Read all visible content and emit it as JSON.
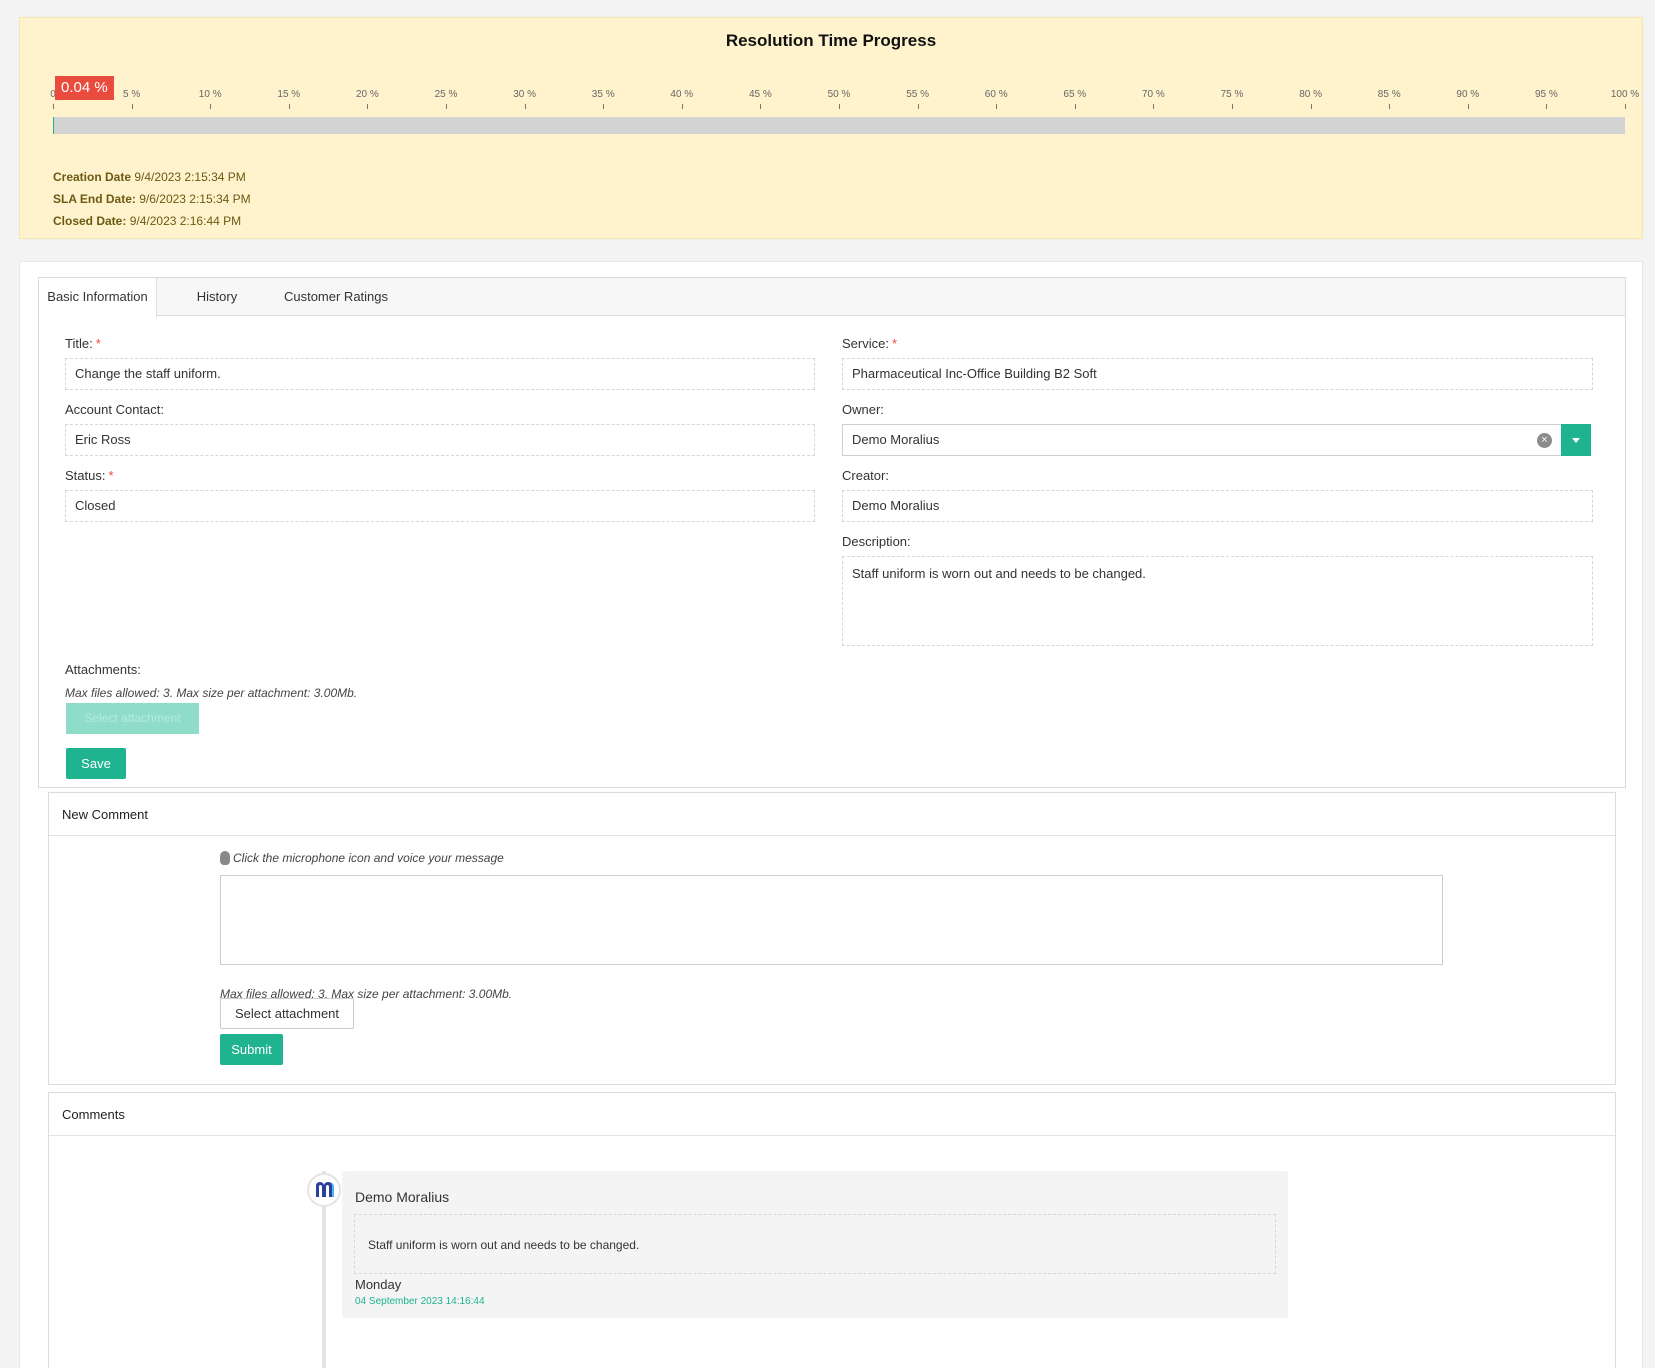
{
  "progress": {
    "title": "Resolution Time Progress",
    "percent_label": "0.04 %",
    "percent_value": 0.04,
    "ticks": [
      "0",
      "5 %",
      "10 %",
      "15 %",
      "20 %",
      "25 %",
      "30 %",
      "35 %",
      "40 %",
      "45 %",
      "50 %",
      "55 %",
      "60 %",
      "65 %",
      "70 %",
      "75 %",
      "80 %",
      "85 %",
      "90 %",
      "95 %",
      "100 %"
    ],
    "creation_label": "Creation Date",
    "creation_value": "9/4/2023 2:15:34 PM",
    "sla_label": "SLA End Date:",
    "sla_value": "9/6/2023 2:15:34 PM",
    "closed_label": "Closed Date:",
    "closed_value": "9/4/2023 2:16:44 PM",
    "colors": {
      "badge": "#e94b3c",
      "fill": "#1fb38f",
      "panel": "#fff3cd"
    }
  },
  "tabs": [
    "Basic Information",
    "History",
    "Customer Ratings"
  ],
  "form": {
    "title_label": "Title:",
    "title_value": "Change the staff uniform.",
    "account_contact_label": "Account Contact:",
    "account_contact_value": "Eric Ross",
    "status_label": "Status:",
    "status_value": "Closed",
    "service_label": "Service:",
    "service_value": "Pharmaceutical Inc-Office Building B2 Soft",
    "owner_label": "Owner:",
    "owner_value": "Demo Moralius",
    "creator_label": "Creator:",
    "creator_value": "Demo Moralius",
    "description_label": "Description:",
    "description_value": "Staff uniform is worn out and needs to be changed.",
    "required_mark": "*",
    "attachments_label": "Attachments:",
    "attachments_hint": "Max files allowed: 3. Max size per attachment: 3.00Mb.",
    "select_attachment": "Select attachment",
    "save": "Save"
  },
  "new_comment": {
    "header": "New Comment",
    "mic_hint": "Click the microphone icon and voice your message",
    "attachments_hint": "Max files allowed: 3. Max size per attachment: 3.00Mb.",
    "select_attachment": "Select attachment",
    "submit": "Submit"
  },
  "comments": {
    "header": "Comments",
    "items": [
      {
        "author": "Demo Moralius",
        "text": "Staff uniform is worn out and needs to be changed.",
        "day": "Monday",
        "date": "04 September 2023 14:16:44"
      }
    ]
  },
  "icons": {
    "clear": "clear-circle-icon",
    "dropdown": "chevron-down-icon",
    "mic": "microphone-icon",
    "avatar": "moralius-logo-icon"
  }
}
